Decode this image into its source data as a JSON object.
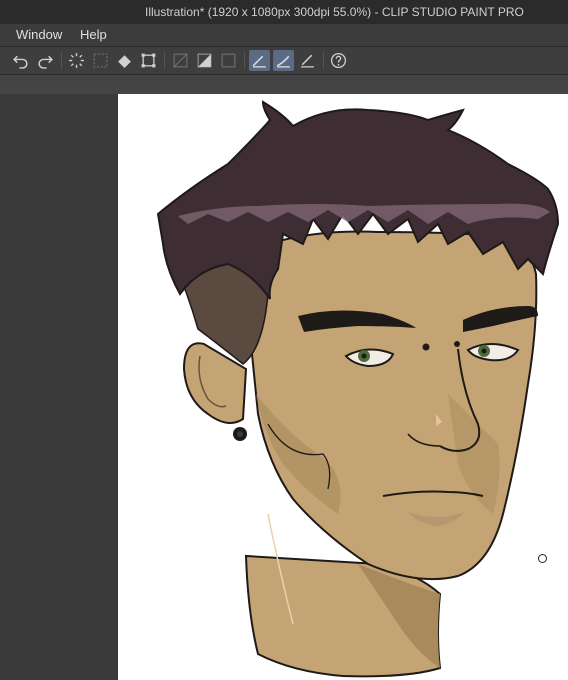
{
  "window": {
    "title": "Illustration* (1920 x 1080px 300dpi 55.0%)  - CLIP STUDIO PAINT PRO"
  },
  "menu": {
    "items": [
      "Window",
      "Help"
    ]
  },
  "toolbar": {
    "buttons": [
      "undo-icon",
      "redo-icon",
      "clear-selection-icon",
      "select-all-icon",
      "fill-icon",
      "transform-icon",
      "layer-mask-icon",
      "clip-icon",
      "reference-layer-icon",
      "draw-line-icon",
      "draw-line-stroke-icon",
      "ruler-snap-icon",
      "help-icon"
    ]
  },
  "colors": {
    "hair": "#3e2e33",
    "skin": "#c4a474",
    "skin_shadow": "#a88a5c",
    "ear_shadow": "#5a4a40",
    "iris": "#4d6b3a",
    "lips": "#b79670"
  }
}
